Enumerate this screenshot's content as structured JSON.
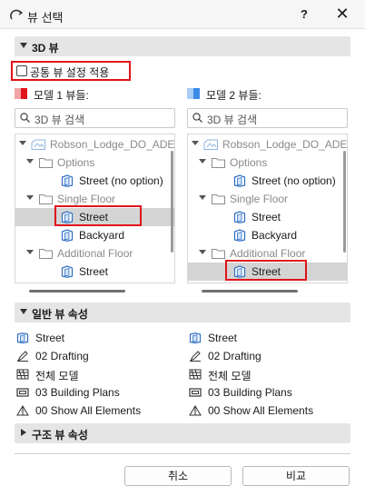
{
  "window": {
    "title": "뷰 선택",
    "help_label": "?",
    "close_label": "✕"
  },
  "view_3d": {
    "header": "3D 뷰",
    "common_settings_label": "공통 뷰 설정 적용",
    "common_settings_checked": false
  },
  "model1": {
    "label": "모델 1 뷰들:",
    "color": "#e0121a",
    "search_placeholder": "3D 뷰 검색",
    "tree": [
      {
        "label": "Robson_Lodge_DO_ADE",
        "type": "project"
      },
      {
        "label": "Options",
        "type": "folder"
      },
      {
        "label": "Street (no option)",
        "type": "view"
      },
      {
        "label": "Single Floor",
        "type": "folder"
      },
      {
        "label": "Street",
        "type": "view",
        "selected": true
      },
      {
        "label": "Backyard",
        "type": "view"
      },
      {
        "label": "Additional Floor",
        "type": "folder"
      },
      {
        "label": "Street",
        "type": "view"
      }
    ]
  },
  "model2": {
    "label": "모델 2 뷰들:",
    "color": "#3b8ce8",
    "search_placeholder": "3D 뷰 검색",
    "tree": [
      {
        "label": "Robson_Lodge_DO_ADE",
        "type": "project"
      },
      {
        "label": "Options",
        "type": "folder"
      },
      {
        "label": "Street (no option)",
        "type": "view"
      },
      {
        "label": "Single Floor",
        "type": "folder"
      },
      {
        "label": "Street",
        "type": "view"
      },
      {
        "label": "Backyard",
        "type": "view"
      },
      {
        "label": "Additional Floor",
        "type": "folder"
      },
      {
        "label": "Street",
        "type": "view",
        "selected": true
      }
    ]
  },
  "general_props": {
    "header": "일반 뷰 속성",
    "left": [
      "Street",
      "02 Drafting",
      "전체 모델",
      "03 Building Plans",
      "00 Show All Elements"
    ],
    "right": [
      "Street",
      "02 Drafting",
      "전체 모델",
      "03 Building Plans",
      "00 Show All Elements"
    ],
    "icons": [
      "view-icon",
      "pen-set-icon",
      "model-filter-icon",
      "layer-combination-icon",
      "partial-structure-icon"
    ]
  },
  "structure_props": {
    "header": "구조 뷰 속성"
  },
  "footer": {
    "cancel_label": "취소",
    "compare_label": "비교"
  }
}
